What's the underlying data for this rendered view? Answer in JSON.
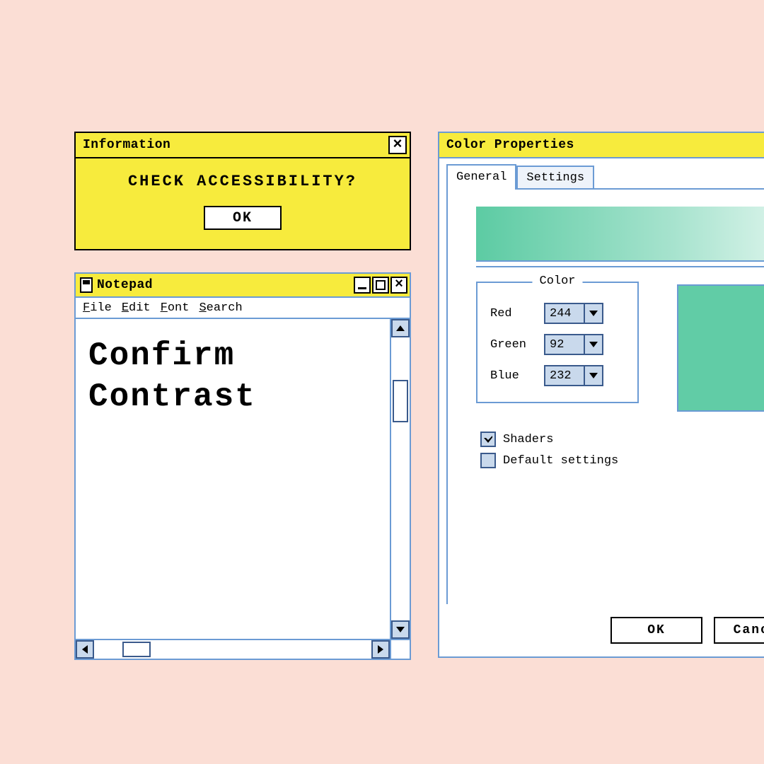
{
  "info": {
    "title": "Information",
    "message": "CHECK ACCESSIBILITY?",
    "ok": "OK"
  },
  "notepad": {
    "title": "Notepad",
    "menu": {
      "file": "File",
      "edit": "Edit",
      "font": "Font",
      "search": "Search"
    },
    "line1": "Confirm",
    "line2": "Contrast"
  },
  "color": {
    "title": "Color Properties",
    "tabs": {
      "general": "General",
      "settings": "Settings"
    },
    "group_legend": "Color",
    "labels": {
      "red": "Red",
      "green": "Green",
      "blue": "Blue"
    },
    "values": {
      "red": "244",
      "green": "92",
      "blue": "232"
    },
    "checks": {
      "shaders": "Shaders",
      "default": "Default settings"
    },
    "ok": "OK",
    "cancel": "Cancel"
  }
}
